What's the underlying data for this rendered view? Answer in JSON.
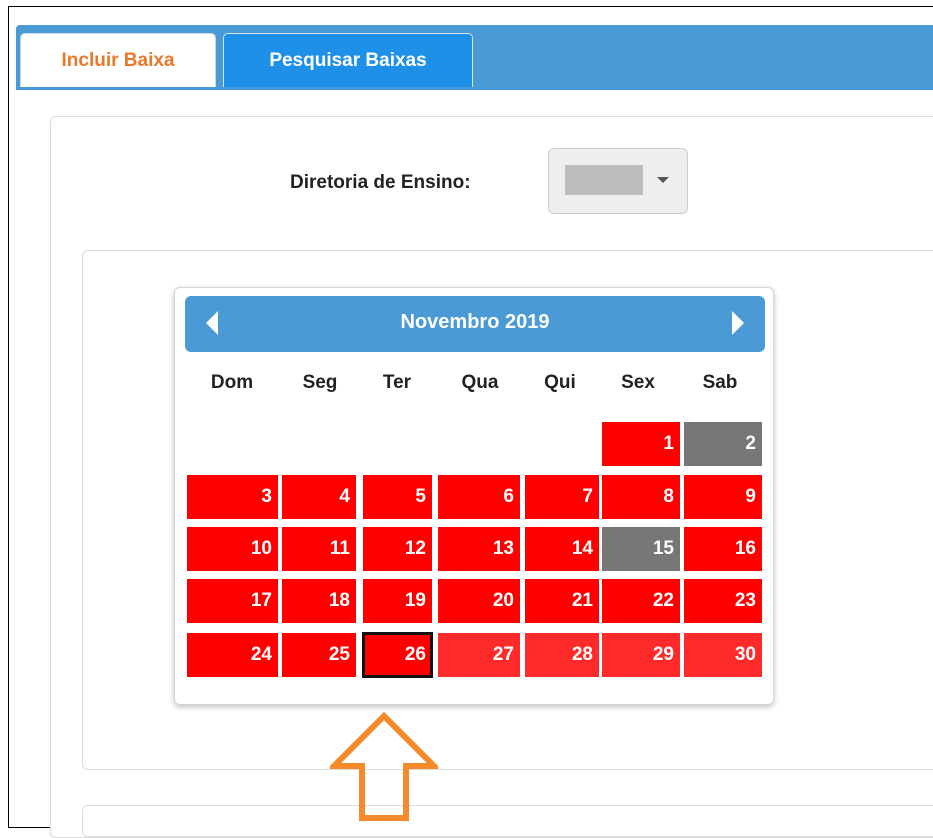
{
  "tabs": [
    {
      "label": "Incluir Baixa",
      "active": true
    },
    {
      "label": "Pesquisar Baixas",
      "active": false
    }
  ],
  "filter": {
    "diretoria_label": "Diretoria de Ensino:",
    "diretoria_value": ""
  },
  "datepicker": {
    "title": "Novembro 2019",
    "prev_icon": "chevron-left-icon",
    "next_icon": "chevron-right-icon",
    "weekdays": [
      "Dom",
      "Seg",
      "Ter",
      "Qua",
      "Qui",
      "Sex",
      "Sab"
    ],
    "weeks": [
      [
        "",
        "",
        "",
        "",
        "",
        "1",
        "2"
      ],
      [
        "3",
        "4",
        "5",
        "6",
        "7",
        "8",
        "9"
      ],
      [
        "10",
        "11",
        "12",
        "13",
        "14",
        "15",
        "16"
      ],
      [
        "17",
        "18",
        "19",
        "20",
        "21",
        "22",
        "23"
      ],
      [
        "24",
        "25",
        "26",
        "27",
        "28",
        "29",
        "30"
      ]
    ],
    "grey_days": [
      "2",
      "15"
    ],
    "selected_day": "26",
    "colors": {
      "header": "#4a9ad6",
      "day_red": "#ff0000",
      "day_grey": "#777777",
      "selected_border": "#111111"
    }
  },
  "annotation": {
    "icon": "arrow-up-icon",
    "color": "#f58a2a"
  }
}
